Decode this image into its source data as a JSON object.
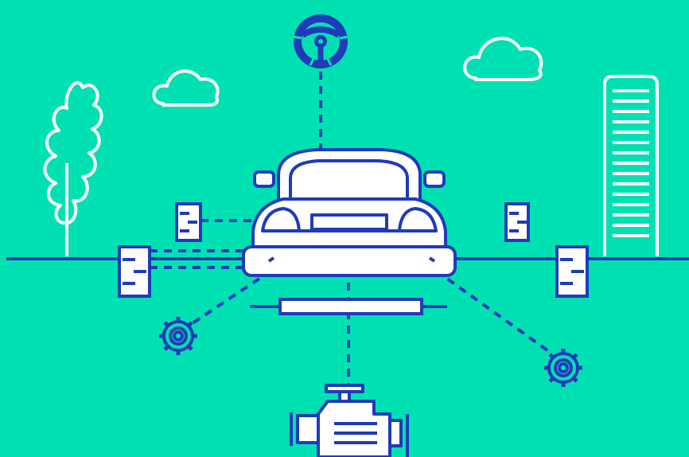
{
  "colors": {
    "background": "#00E1B3",
    "line": "#1F3BB8",
    "outline_white": "#FFFFFF",
    "fill_white": "#FFFFFF"
  },
  "icons": [
    "steering-wheel-icon",
    "car-icon",
    "engine-icon",
    "gear-icon",
    "tire-icon",
    "axle-icon",
    "cloud-icon",
    "tree-icon",
    "building-icon"
  ]
}
